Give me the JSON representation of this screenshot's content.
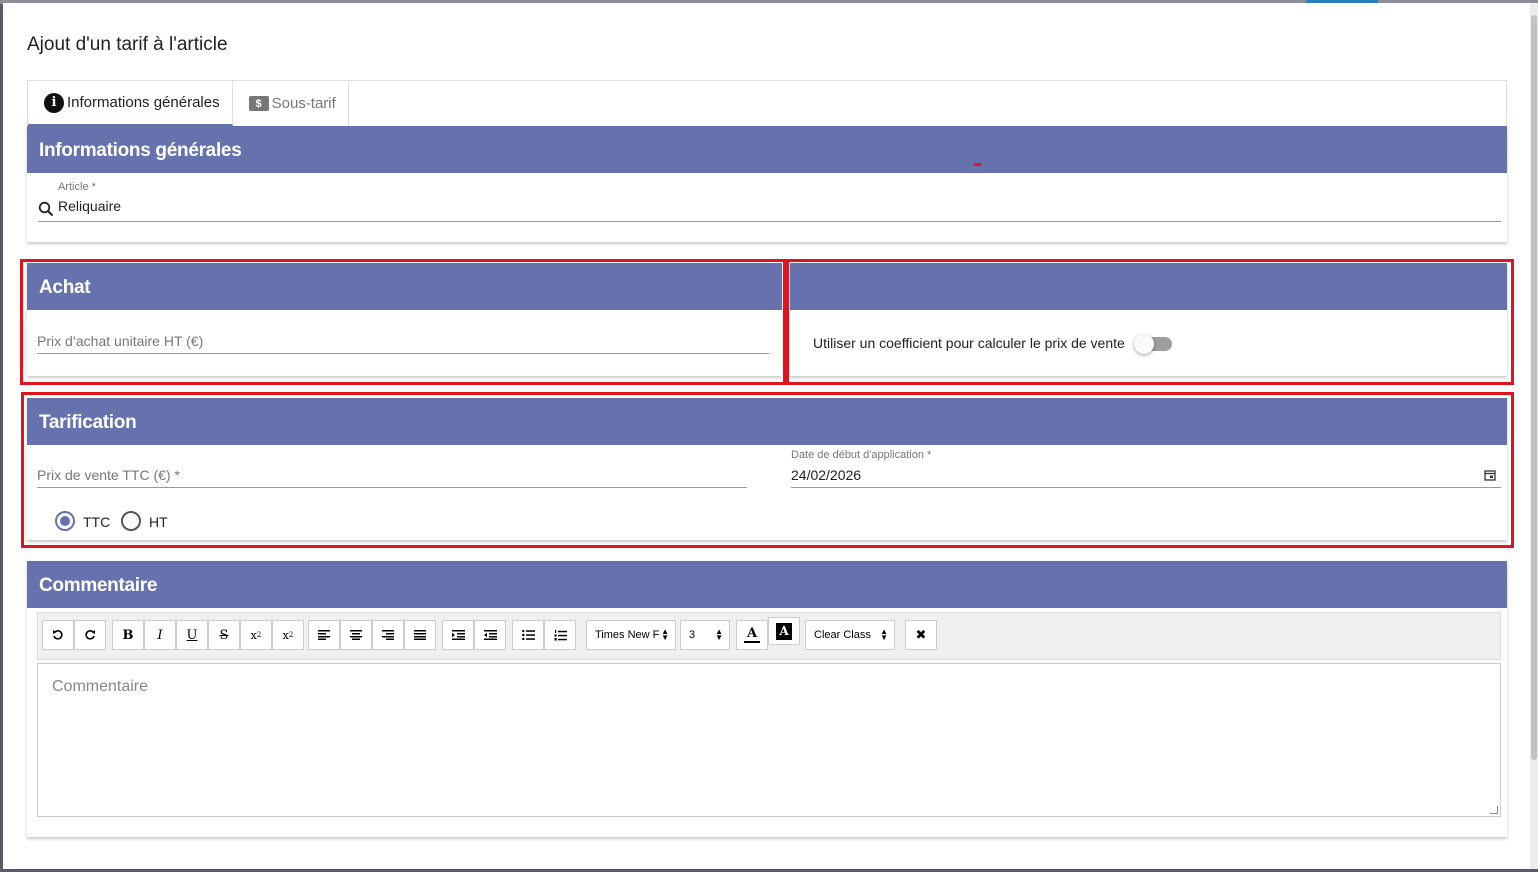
{
  "modal": {
    "title": "Ajout d'un tarif à l'article"
  },
  "tabs": [
    {
      "label": "Informations générales",
      "icon": "info-icon",
      "active": true
    },
    {
      "label": "Sous-tarif",
      "icon": "money-icon",
      "active": false
    }
  ],
  "general": {
    "header": "Informations générales",
    "article_label": "Article *",
    "article_value": "Reliquaire"
  },
  "achat": {
    "header": "Achat",
    "prix_achat_placeholder": "Prix d’achat unitaire HT (€)"
  },
  "coefficient": {
    "toggle_label": "Utiliser un coefficient pour calculer le prix de vente",
    "toggle_on": false
  },
  "tarification": {
    "header": "Tarification",
    "prix_vente_placeholder": "Prix de vente TTC (€) *",
    "date_label": "Date de début d'application *",
    "date_value": "24/02/2026",
    "radio_ttc": "TTC",
    "radio_ht": "HT",
    "selected": "TTC"
  },
  "commentaire": {
    "header": "Commentaire",
    "placeholder": "Commentaire",
    "font_select": "Times New F",
    "size_select": "3",
    "class_select": "Clear Class"
  },
  "colors": {
    "header_bg": "#6672ae",
    "highlight": "#e0141e"
  }
}
